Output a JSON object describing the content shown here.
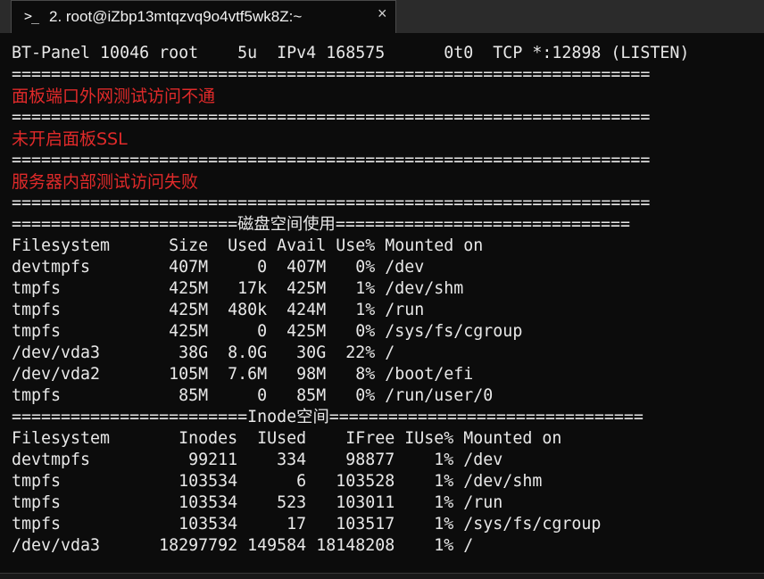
{
  "tab": {
    "icon": "terminal-prompt-icon",
    "icon_glyph": ">_",
    "title": "2. root@iZbp13mtqzvq9o4vtf5wk8Z:~",
    "close_glyph": "×"
  },
  "terminal": {
    "lines": [
      {
        "text": "BT-Panel 10046 root    5u  IPv4 168575      0t0  TCP *:12898 (LISTEN)",
        "style": "normal"
      },
      {
        "text": "=================================================================",
        "style": "normal"
      },
      {
        "text": "面板端口外网测试访问不通",
        "style": "red"
      },
      {
        "text": "=================================================================",
        "style": "normal"
      },
      {
        "text": "未开启面板SSL",
        "style": "red"
      },
      {
        "text": "=================================================================",
        "style": "normal"
      },
      {
        "text": "服务器内部测试访问失败",
        "style": "red"
      },
      {
        "text": "=================================================================",
        "style": "normal"
      },
      {
        "text": "=======================磁盘空间使用==============================",
        "style": "normal"
      },
      {
        "text": "Filesystem      Size  Used Avail Use% Mounted on",
        "style": "normal"
      },
      {
        "text": "devtmpfs        407M     0  407M   0% /dev",
        "style": "normal"
      },
      {
        "text": "tmpfs           425M   17k  425M   1% /dev/shm",
        "style": "normal"
      },
      {
        "text": "tmpfs           425M  480k  424M   1% /run",
        "style": "normal"
      },
      {
        "text": "tmpfs           425M     0  425M   0% /sys/fs/cgroup",
        "style": "normal"
      },
      {
        "text": "/dev/vda3        38G  8.0G   30G  22% /",
        "style": "normal"
      },
      {
        "text": "/dev/vda2       105M  7.6M   98M   8% /boot/efi",
        "style": "normal"
      },
      {
        "text": "tmpfs            85M     0   85M   0% /run/user/0",
        "style": "normal"
      },
      {
        "text": "========================Inode空间================================",
        "style": "normal"
      },
      {
        "text": "Filesystem       Inodes  IUsed    IFree IUse% Mounted on",
        "style": "normal"
      },
      {
        "text": "devtmpfs          99211    334    98877    1% /dev",
        "style": "normal"
      },
      {
        "text": "tmpfs            103534      6   103528    1% /dev/shm",
        "style": "normal"
      },
      {
        "text": "tmpfs            103534    523   103011    1% /run",
        "style": "normal"
      },
      {
        "text": "tmpfs            103534     17   103517    1% /sys/fs/cgroup",
        "style": "normal"
      },
      {
        "text": "/dev/vda3      18297792 149584 18148208    1% /",
        "style": "normal"
      }
    ]
  },
  "colors": {
    "background": "#0c0c0c",
    "foreground": "#e8e8e8",
    "error_red": "#e02a2a",
    "tabbar": "#2b2b2b"
  }
}
